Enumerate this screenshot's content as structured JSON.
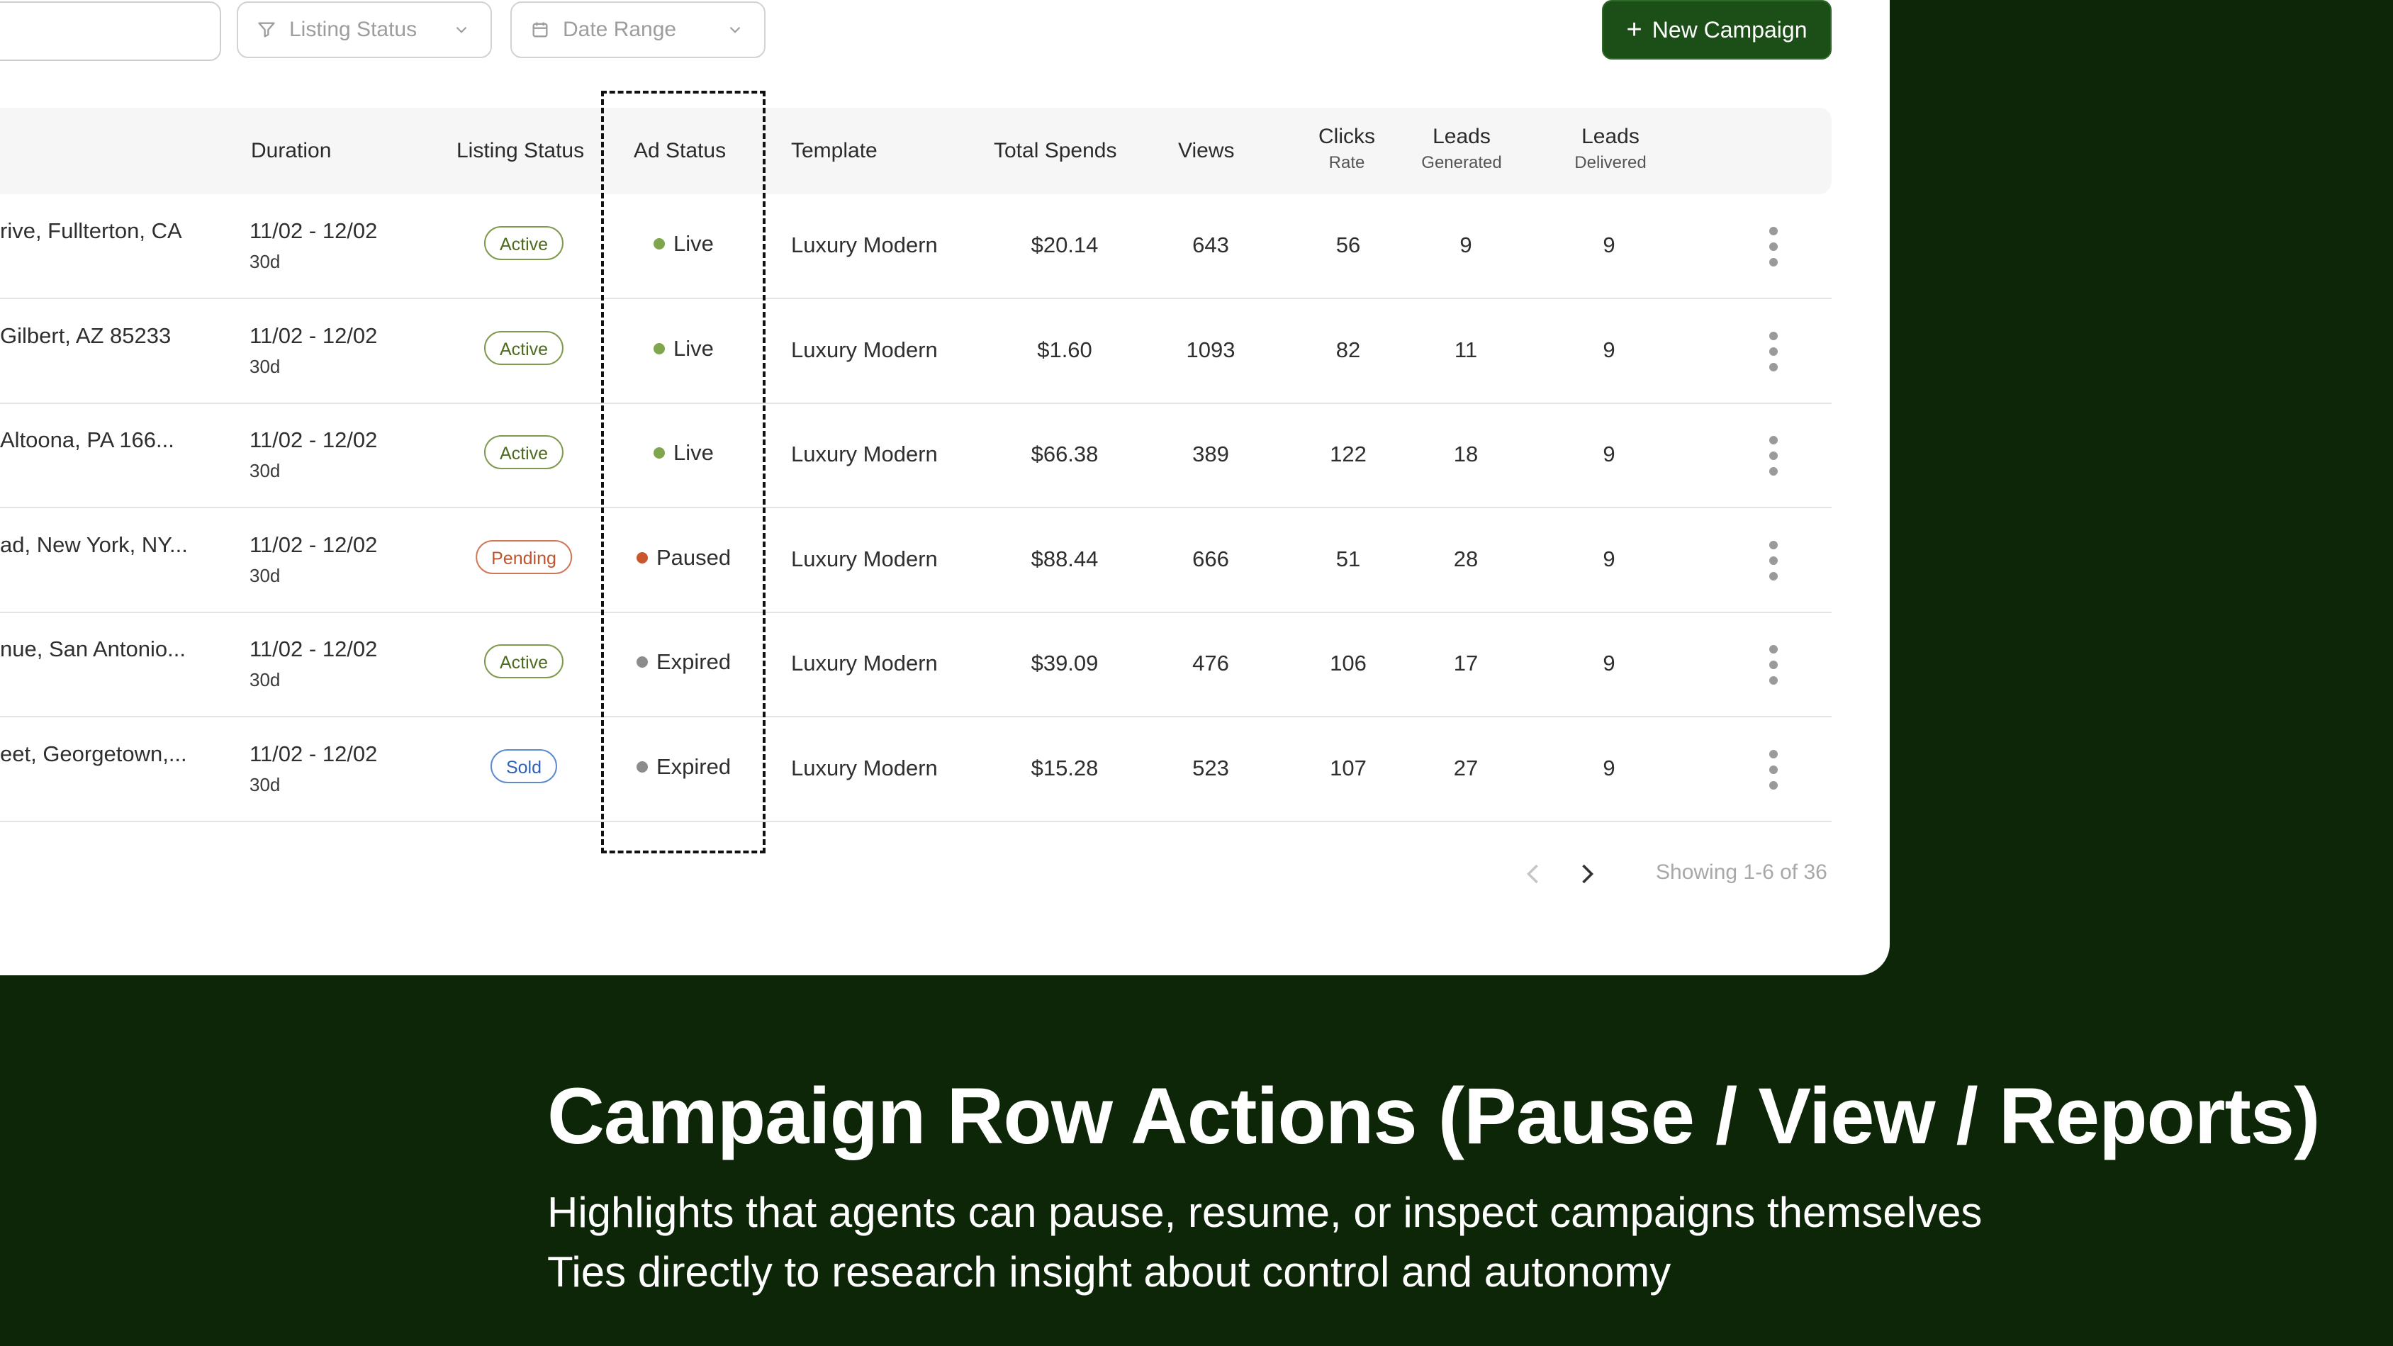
{
  "toolbar": {
    "listing_status_placeholder": "Listing Status",
    "date_range_placeholder": "Date Range",
    "new_campaign_label": "New Campaign"
  },
  "table": {
    "headers": {
      "duration": "Duration",
      "listing_status": "Listing Status",
      "ad_status": "Ad Status",
      "template": "Template",
      "total_spends": "Total Spends",
      "views": "Views",
      "clicks": "Clicks",
      "clicks_sub": "Rate",
      "leads_gen": "Leads",
      "leads_gen_sub": "Generated",
      "leads_del": "Leads",
      "leads_del_sub": "Delivered"
    },
    "rows": [
      {
        "address": "rive, Fullterton, CA",
        "duration": "11/02 - 12/02",
        "days": "30d",
        "listing": "Active",
        "ad_status": "Live",
        "template": "Luxury Modern",
        "spend": "$20.14",
        "views": "643",
        "clicks": "56",
        "leads_gen": "9",
        "leads_del": "9"
      },
      {
        "address": "Gilbert, AZ 85233",
        "duration": "11/02 - 12/02",
        "days": "30d",
        "listing": "Active",
        "ad_status": "Live",
        "template": "Luxury Modern",
        "spend": "$1.60",
        "views": "1093",
        "clicks": "82",
        "leads_gen": "11",
        "leads_del": "9"
      },
      {
        "address": "Altoona, PA 166...",
        "duration": "11/02 - 12/02",
        "days": "30d",
        "listing": "Active",
        "ad_status": "Live",
        "template": "Luxury Modern",
        "spend": "$66.38",
        "views": "389",
        "clicks": "122",
        "leads_gen": "18",
        "leads_del": "9"
      },
      {
        "address": "ad, New York, NY...",
        "duration": "11/02 - 12/02",
        "days": "30d",
        "listing": "Pending",
        "ad_status": "Paused",
        "template": "Luxury Modern",
        "spend": "$88.44",
        "views": "666",
        "clicks": "51",
        "leads_gen": "28",
        "leads_del": "9"
      },
      {
        "address": "nue, San Antonio...",
        "duration": "11/02 - 12/02",
        "days": "30d",
        "listing": "Active",
        "ad_status": "Expired",
        "template": "Luxury Modern",
        "spend": "$39.09",
        "views": "476",
        "clicks": "106",
        "leads_gen": "17",
        "leads_del": "9"
      },
      {
        "address": "eet, Georgetown,...",
        "duration": "11/02 - 12/02",
        "days": "30d",
        "listing": "Sold",
        "ad_status": "Expired",
        "template": "Luxury Modern",
        "spend": "$15.28",
        "views": "523",
        "clicks": "107",
        "leads_gen": "27",
        "leads_del": "9"
      }
    ]
  },
  "pagination": {
    "showing": "Showing 1-6 of 36"
  },
  "slide": {
    "title": "Campaign Row Actions (Pause / View / Reports)",
    "line1": "Highlights that agents can pause, resume, or inspect campaigns themselves",
    "line2": "Ties directly to research insight about control and autonomy"
  },
  "colors": {
    "live": "#7fa64c",
    "paused": "#c9562c",
    "expired": "#8c8c8c",
    "brand": "#1c4f18",
    "background": "#0d2608"
  }
}
